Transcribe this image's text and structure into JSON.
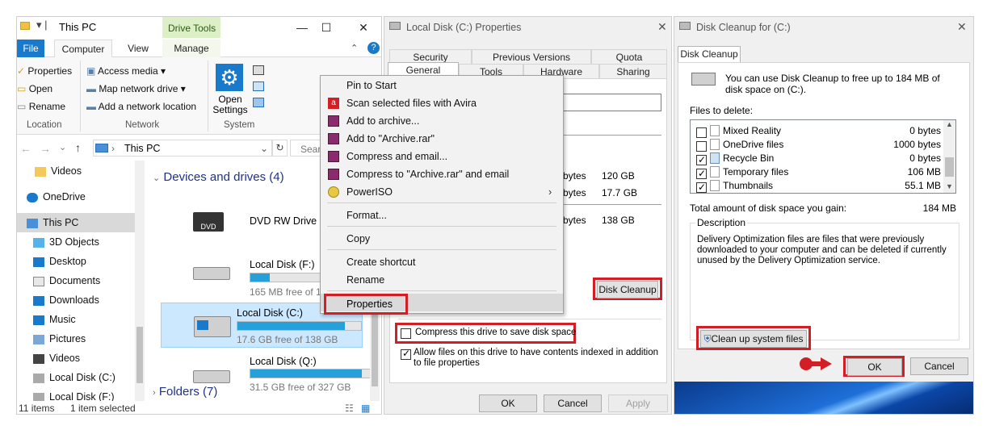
{
  "explorer": {
    "title": "This PC",
    "drive_tools": "Drive Tools",
    "tabs": [
      "File",
      "Computer",
      "View",
      "Manage"
    ],
    "ribbon": {
      "location_items": [
        "Properties",
        "Open",
        "Rename"
      ],
      "location_label": "Location",
      "network_items": [
        "Access media",
        "Map network drive",
        "Add a network location"
      ],
      "network_label": "Network",
      "open_settings": "Open Settings",
      "system_label": "System"
    },
    "address": "This PC",
    "search_placeholder": "Sear",
    "nav": [
      "Videos",
      "OneDrive",
      "This PC",
      "3D Objects",
      "Desktop",
      "Documents",
      "Downloads",
      "Music",
      "Pictures",
      "Videos",
      "Local Disk (C:)",
      "Local Disk (F:)"
    ],
    "devices_header": "Devices and drives (4)",
    "drives": [
      {
        "name": "DVD RW Drive (E:)",
        "free": "",
        "used": 0
      },
      {
        "name": "Local Disk (F:)",
        "free": "165 MB free of 197 MB",
        "used": 0.16
      },
      {
        "name": "Local Disk (C:)",
        "free": "17.6 GB free of 138 GB",
        "used": 0.87
      },
      {
        "name": "Local Disk (Q:)",
        "free": "31.5 GB free of 327 GB",
        "used": 0.9
      }
    ],
    "folders_header": "Folders (7)",
    "status_items": "11 items",
    "status_selected": "1 item selected"
  },
  "context_menu": {
    "items": [
      "Pin to Start",
      "Scan selected files with Avira",
      "Add to archive...",
      "Add to \"Archive.rar\"",
      "Compress and email...",
      "Compress to \"Archive.rar\" and email",
      "PowerISO",
      "Format...",
      "Copy",
      "Create shortcut",
      "Rename",
      "Properties"
    ]
  },
  "properties": {
    "title": "Local Disk (C:) Properties",
    "tabs_top": [
      "Security",
      "Previous Versions",
      "Quota"
    ],
    "tabs_bottom": [
      "General",
      "Tools",
      "Hardware",
      "Sharing"
    ],
    "values": [
      "bytes",
      "120 GB",
      "bytes",
      "17.7 GB",
      "bytes",
      "138 GB"
    ],
    "disk_cleanup": "Disk Cleanup",
    "compress_label": "Compress this drive to save disk space",
    "index_label": "Allow files on this drive to have contents indexed in addition to file properties",
    "ok": "OK",
    "cancel": "Cancel",
    "apply": "Apply"
  },
  "cleanup": {
    "title": "Disk Cleanup for  (C:)",
    "tab": "Disk Cleanup",
    "intro": "You can use Disk Cleanup to free up to 184 MB of disk space on  (C:).",
    "files_label": "Files to delete:",
    "files": [
      {
        "name": "Mixed Reality",
        "size": "0 bytes",
        "checked": false
      },
      {
        "name": "OneDrive files",
        "size": "1000 bytes",
        "checked": false
      },
      {
        "name": "Recycle Bin",
        "size": "0 bytes",
        "checked": true
      },
      {
        "name": "Temporary files",
        "size": "106 MB",
        "checked": true
      },
      {
        "name": "Thumbnails",
        "size": "55.1 MB",
        "checked": true
      }
    ],
    "total_label": "Total amount of disk space you gain:",
    "total_value": "184 MB",
    "description_label": "Description",
    "description": "Delivery Optimization files are files that were previously downloaded to your computer and can be deleted if currently unused by the Delivery Optimization service.",
    "cleanup_system": "Clean up system files",
    "ok": "OK",
    "cancel": "Cancel"
  },
  "colors": {
    "accent": "#1979ca",
    "highlight": "#d21f26",
    "selection": "#cce8ff",
    "bar": "#26a0da"
  }
}
